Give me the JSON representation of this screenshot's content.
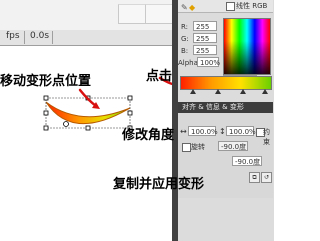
{
  "stage": {
    "fps_label": "fps",
    "time_label": "0.0s"
  },
  "color_mixer": {
    "r_value": "255",
    "g_value": "255",
    "b_value": "255",
    "alpha_label": "Alpha:",
    "alpha_value": "100%",
    "hex_value": "#FFFFFF",
    "linear_rgb_label": "线性 RGB"
  },
  "transform_panel": {
    "title": "对齐 & 信息 & 变形",
    "width_scale": "100.0%",
    "height_scale": "100.0%",
    "constrain_label": "约束",
    "rotate_label": "旋转",
    "rotate_value": "-90.0度",
    "skew_value": "-90.0度"
  },
  "annotations": {
    "move_point": "移动变形点位置",
    "click": "点击",
    "modify_angle": "修改角度",
    "copy_apply": "复制并应用变形"
  },
  "colors": {
    "annotation_arrow": "#d81010",
    "gradient_start": "#ff2000",
    "gradient_end": "#6ad000",
    "panel_header": "#3d3d3d"
  }
}
